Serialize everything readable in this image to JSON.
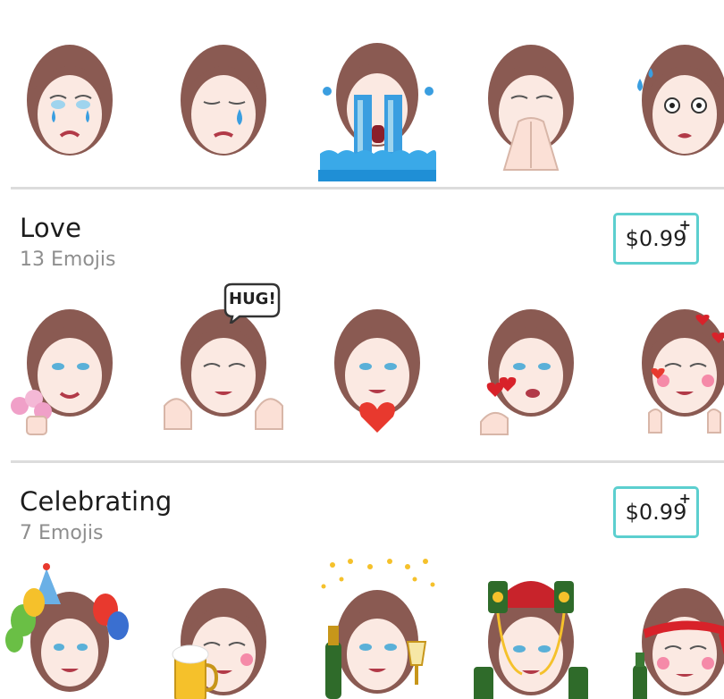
{
  "packs": [
    {
      "title": "Love",
      "count_label": "13 Emojis",
      "price_label": "$0.99",
      "price_badge": "+"
    },
    {
      "title": "Celebrating",
      "count_label": "7 Emojis",
      "price_label": "$0.99",
      "price_badge": "+"
    }
  ],
  "stickers": {
    "hug_bubble": "HUG!"
  },
  "colors": {
    "accent": "#5ccfcf",
    "hair": "#8a5a52",
    "skin": "#fbe9e2",
    "tears": "#3a9ee0",
    "heart": "#d8222a"
  }
}
